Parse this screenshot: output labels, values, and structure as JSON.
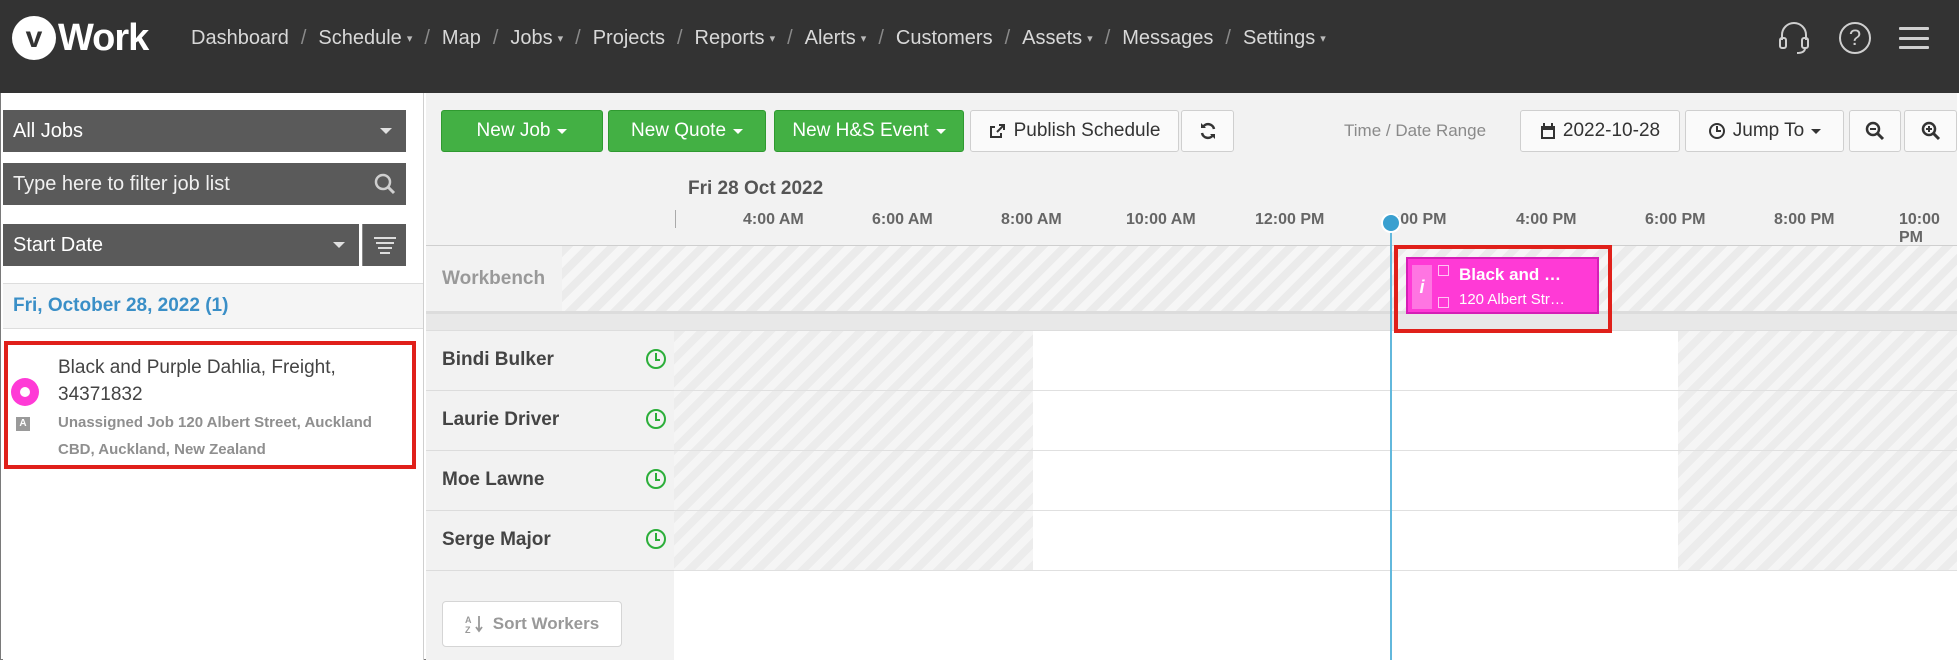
{
  "app": {
    "logo_letter": "v",
    "logo_text": "Work"
  },
  "nav": {
    "items": [
      {
        "label": "Dashboard",
        "dropdown": false
      },
      {
        "label": "Schedule",
        "dropdown": true
      },
      {
        "label": "Map",
        "dropdown": false
      },
      {
        "label": "Jobs",
        "dropdown": true
      },
      {
        "label": "Projects",
        "dropdown": false
      },
      {
        "label": "Reports",
        "dropdown": true
      },
      {
        "label": "Alerts",
        "dropdown": true
      },
      {
        "label": "Customers",
        "dropdown": false
      },
      {
        "label": "Assets",
        "dropdown": true
      },
      {
        "label": "Messages",
        "dropdown": false
      },
      {
        "label": "Settings",
        "dropdown": true
      }
    ],
    "separator": "/",
    "right_icons": [
      "headset-icon",
      "help-icon",
      "menu-icon"
    ],
    "help_glyph": "?"
  },
  "sidebar": {
    "job_filter_value": "All Jobs",
    "search_placeholder": "Type here to filter job list",
    "sort_value": "Start Date",
    "date_group": "Fri, October 28, 2022 (1)",
    "job": {
      "title": "Black and Purple Dahlia, Freight, 34371832",
      "badge": "A",
      "detail": "Unassigned Job 120 Albert Street, Auckland CBD, Auckland, New Zealand",
      "color": "#ff3ad6"
    }
  },
  "toolbar": {
    "new_job": "New Job",
    "new_quote": "New Quote",
    "new_hs_event": "New H&S Event",
    "publish_schedule": "Publish Schedule",
    "range_label": "Time / Date Range",
    "date_value": "2022-10-28",
    "jump_to": "Jump To"
  },
  "timeline": {
    "date_title": "Fri 28 Oct 2022",
    "ticks": [
      "4:00 AM",
      "6:00 AM",
      "8:00 AM",
      "10:00 AM",
      "12:00 PM",
      "2:00 PM",
      "4:00 PM",
      "6:00 PM",
      "8:00 PM",
      "10:00 PM"
    ],
    "now_label": "2:00 PM"
  },
  "workbench": {
    "label": "Workbench",
    "card_title": "Black and …",
    "card_address": "120 Albert Str…",
    "card_info": "i"
  },
  "workers": [
    {
      "name": "Bindi Bulker"
    },
    {
      "name": "Laurie Driver"
    },
    {
      "name": "Moe Lawne"
    },
    {
      "name": "Serge Major"
    }
  ],
  "sort_workers_label": "Sort Workers",
  "colors": {
    "accent_green": "#43b044",
    "job_pink": "#ff3ad6",
    "highlight_red": "#e0201a",
    "now_line": "#62b8dc",
    "date_blue": "#3a8fc7"
  }
}
